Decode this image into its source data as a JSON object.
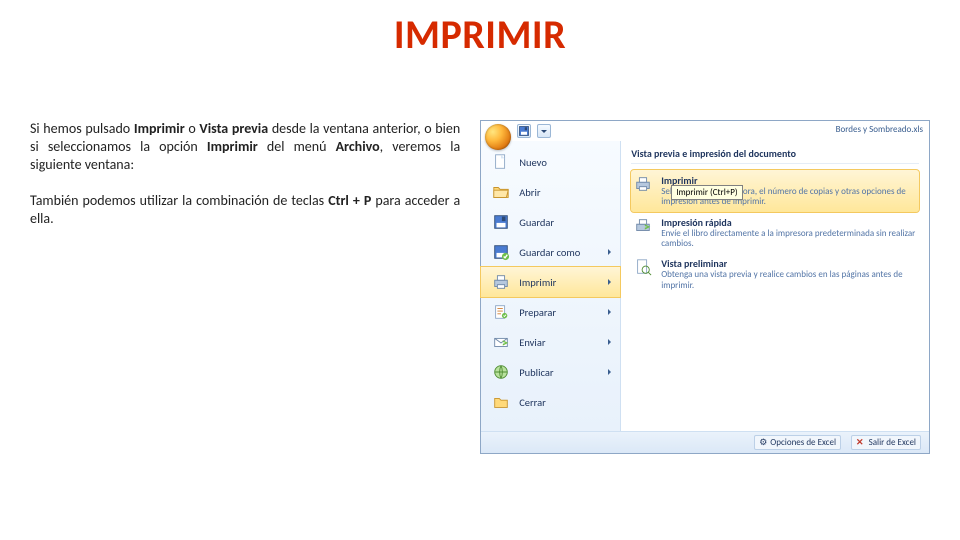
{
  "title": "IMPRIMIR",
  "paragraphs": {
    "p1_a": "Si hemos pulsado ",
    "p1_b1": "Imprimir",
    "p1_c": " o ",
    "p1_b2": "Vista previa",
    "p1_d": " desde la ventana anterior, o bien si seleccionamos la opción ",
    "p1_b3": "Imprimir",
    "p1_e": " del menú ",
    "p1_b4": "Archivo",
    "p1_f": ", veremos la siguiente ventana:",
    "p2_a": "También podemos utilizar la combinación de teclas ",
    "p2_b": "Ctrl + P",
    "p2_c": " para acceder a ella."
  },
  "office": {
    "window_title": "Bordes y Sombreado.xls",
    "left": {
      "nuevo": "Nuevo",
      "abrir": "Abrir",
      "guardar": "Guardar",
      "guardar_como": "Guardar como",
      "imprimir": "Imprimir",
      "preparar": "Preparar",
      "enviar": "Enviar",
      "publicar": "Publicar",
      "cerrar": "Cerrar"
    },
    "right": {
      "header": "Vista previa e impresión del documento",
      "imprimir": {
        "t": "Imprimir",
        "d": "Seleccione una impresora, el número de copias y otras opciones de impresión antes de imprimir."
      },
      "tooltip": "Imprimir (Ctrl+P)",
      "rapida": {
        "t": "Impresión rápida",
        "d": "Envíe el libro directamente a la impresora predeterminada sin realizar cambios."
      },
      "preliminar": {
        "t": "Vista preliminar",
        "d": "Obtenga una vista previa y realice cambios en las páginas antes de imprimir."
      }
    },
    "footer": {
      "opciones": "Opciones de Excel",
      "salir": "Salir de Excel"
    }
  }
}
